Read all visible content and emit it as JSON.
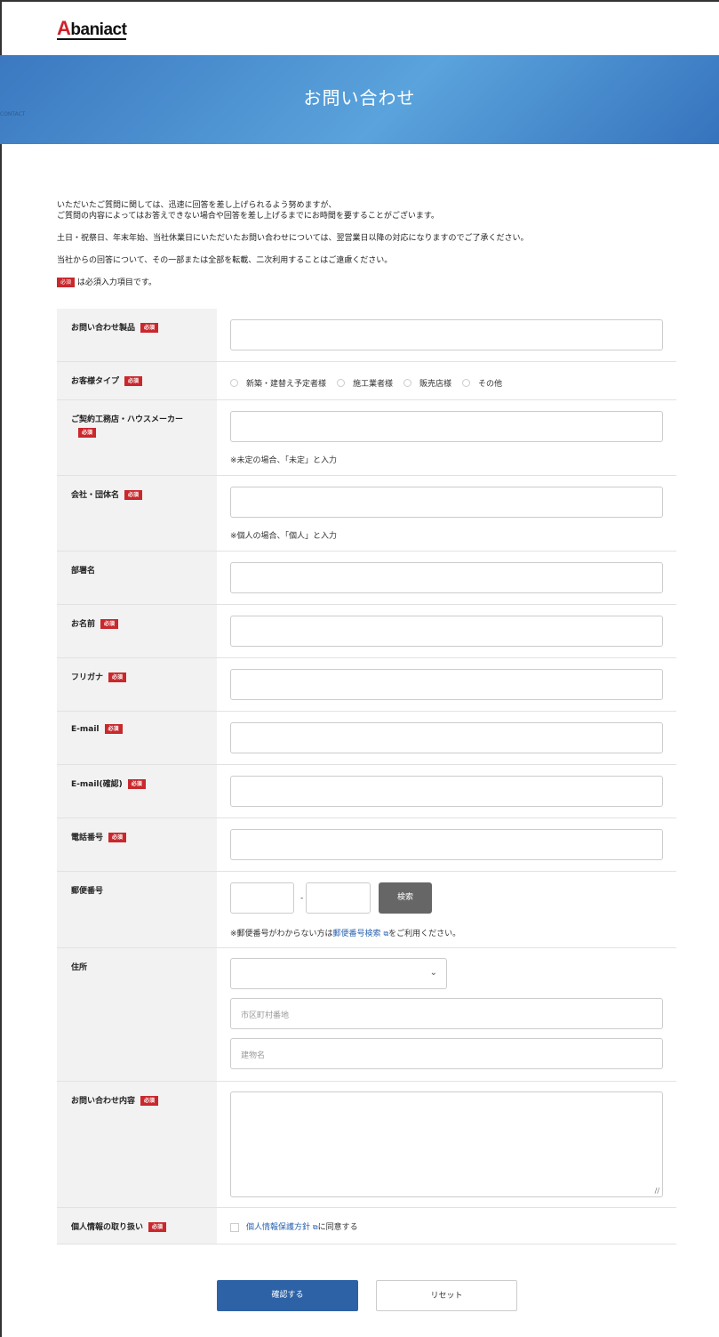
{
  "brand": {
    "logo_letter": "A",
    "logo_rest": "baniact"
  },
  "hero": {
    "title": "お問い合わせ",
    "subtitle": "CONTACT"
  },
  "intro": {
    "line1": "いただいたご質問に関しては、迅速に回答を差し上げられるよう努めますが、",
    "line2": "ご質問の内容によってはお答えできない場合や回答を差し上げるまでにお時間を要することがございます。",
    "line3": "土日・祝祭日、年末年始、当社休業日にいただいたお問い合わせについては、翌営業日以降の対応になりますのでご了承ください。",
    "line4": "当社からの回答について、その一部または全部を転載、二次利用することはご遠慮ください。",
    "required_badge": "必須",
    "required_note": "は必須入力項目です。"
  },
  "form": {
    "product": {
      "label": "お問い合わせ製品",
      "badge": "必須",
      "value": ""
    },
    "customer_type": {
      "label": "お客様タイプ",
      "badge": "必須",
      "options": [
        "新築・建替え予定者様",
        "施工業者様",
        "販売店様",
        "その他"
      ]
    },
    "contractor": {
      "label": "ご契約工務店・ハウスメーカー",
      "badge": "必須",
      "value": "",
      "note": "※未定の場合、「未定」と入力"
    },
    "company": {
      "label": "会社・団体名",
      "badge": "必須",
      "value": "",
      "note": "※個人の場合、「個人」と入力"
    },
    "department": {
      "label": "部署名",
      "value": ""
    },
    "name": {
      "label": "お名前",
      "badge": "必須",
      "value": ""
    },
    "furigana": {
      "label": "フリガナ",
      "badge": "必須",
      "value": ""
    },
    "email": {
      "label": "E-mail",
      "badge": "必須",
      "value": ""
    },
    "email_confirm": {
      "label": "E-mail(確認)",
      "badge": "必須",
      "value": ""
    },
    "phone": {
      "label": "電話番号",
      "badge": "必須",
      "value": ""
    },
    "postal": {
      "label": "郵便番号",
      "separator": "-",
      "search_button": "検索",
      "note_prefix": "※郵便番号がわからない方は",
      "note_link": "郵便番号検索",
      "note_suffix": "をご利用ください。"
    },
    "address": {
      "label": "住所",
      "prefecture_value": "",
      "city_placeholder": "市区町村番地",
      "building_placeholder": "建物名"
    },
    "inquiry": {
      "label": "お問い合わせ内容",
      "badge": "必須",
      "value": ""
    },
    "privacy": {
      "label": "個人情報の取り扱い",
      "badge": "必須",
      "link": "個人情報保護方針",
      "suffix": "に同意する"
    }
  },
  "actions": {
    "confirm": "確認する",
    "reset": "リセット"
  },
  "colors": {
    "accent": "#2d63a6",
    "required": "#c9282d",
    "hero_start": "#3b78c0",
    "hero_mid": "#5aa3dc"
  }
}
